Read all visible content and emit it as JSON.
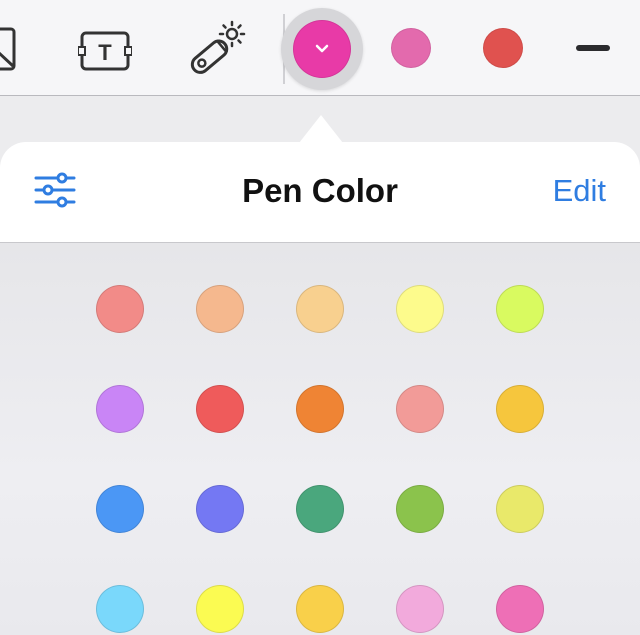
{
  "toolbar": {
    "tools": [
      {
        "name": "image-icon"
      },
      {
        "name": "text-box-icon",
        "glyph": "T"
      },
      {
        "name": "laser-pointer-icon"
      }
    ],
    "selected_color": "#e83aa7",
    "recent_colors": [
      "#e36aad",
      "#e0524f"
    ],
    "line_width_icon": "line-width-icon"
  },
  "panel": {
    "title": "Pen Color",
    "edit_label": "Edit",
    "settings_icon": "sliders-icon"
  },
  "palette": {
    "rows": [
      [
        "#f28b88",
        "#f5b88e",
        "#f8d08f",
        "#fdfb8c",
        "#d9fa60"
      ],
      [
        "#c985f6",
        "#ef5b5b",
        "#ef8434",
        "#f29b98",
        "#f6c63d"
      ],
      [
        "#4b97f5",
        "#7478f3",
        "#4aa77d",
        "#8bc34c",
        "#e9e96a"
      ],
      [
        "#7ad8fb",
        "#fbfb52",
        "#f9d04a",
        "#f2aadc",
        "#ee6fb6"
      ]
    ]
  }
}
